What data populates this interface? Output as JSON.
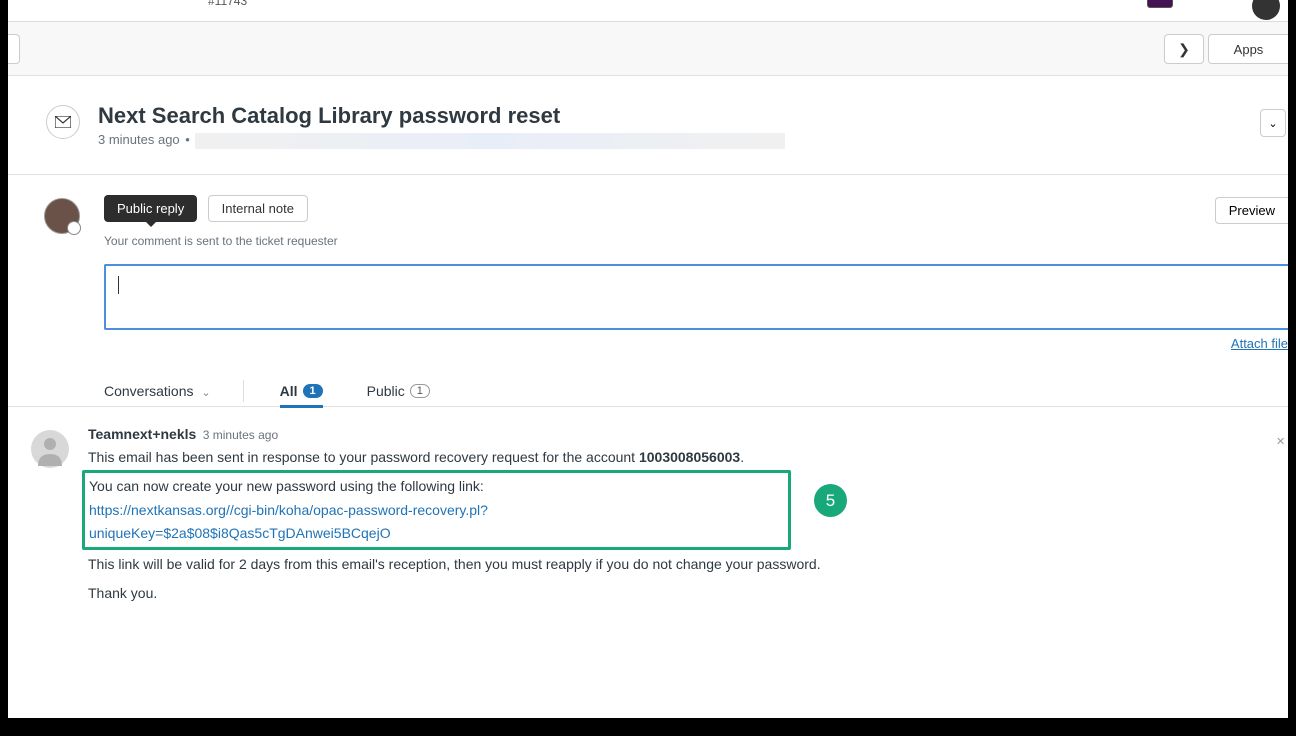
{
  "tab": {
    "label": "#11743"
  },
  "toolbar": {
    "apps_label": "Apps"
  },
  "header": {
    "title": "Next Search Catalog Library password reset",
    "timestamp": "3 minutes ago"
  },
  "reply": {
    "public_label": "Public reply",
    "internal_label": "Internal note",
    "preview_label": "Preview",
    "hint": "Your comment is sent to the ticket requester",
    "attach_label": "Attach file"
  },
  "filters": {
    "conversations_label": "Conversations",
    "all_label": "All",
    "all_count": "1",
    "public_label": "Public",
    "public_count": "1"
  },
  "message": {
    "from": "Teamnext+nekls",
    "time": "3 minutes ago",
    "intro_prefix": "This email has been sent in response to your password recovery request for the account ",
    "account_num": "1003008056003",
    "intro_suffix": ".",
    "link_intro": "You can now create your new password using the following link:",
    "link_url": "https://nextkansas.org//cgi-bin/koha/opac-password-recovery.pl?uniqueKey=$2a$08$i8Qas5cTgDAnwei5BCqejO",
    "validity": "This link will be valid for 2 days from this email's reception, then you must reapply if you do not change your password.",
    "thanks": "Thank you."
  },
  "annotation": {
    "number": "5"
  }
}
